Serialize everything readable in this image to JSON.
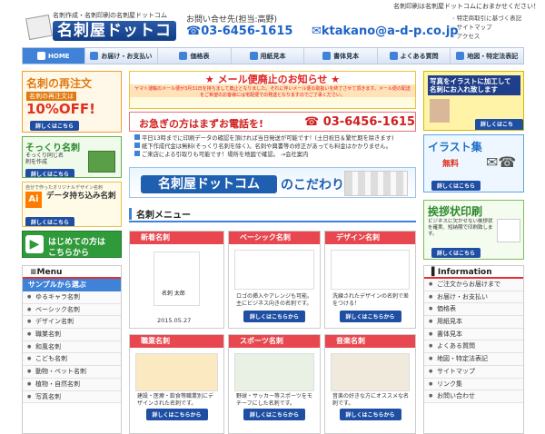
{
  "header": {
    "top_note": "名刺印刷は名刺屋ドットコムにおまかせください！",
    "logo_sub": "名刺作成・名刺印刷の名刺屋ドットコム",
    "logo_main": "名刺屋ドットコム",
    "contact_label": "お問い合せ先(担当:高野)",
    "phone": "03-6456-1615",
    "email": "ktakano@a-d-p.co.jp",
    "links": [
      "特定商取引に基づく表記",
      "サイトマップ",
      "アクセス"
    ]
  },
  "nav": [
    {
      "label": "HOME",
      "icon": "home-icon"
    },
    {
      "label": "お届け・お支払い",
      "icon": "truck-icon"
    },
    {
      "label": "価格表",
      "icon": "yen-icon"
    },
    {
      "label": "用紙見本",
      "icon": "paper-icon"
    },
    {
      "label": "書体見本",
      "icon": "font-icon"
    },
    {
      "label": "よくある質問",
      "icon": "question-icon"
    },
    {
      "label": "地図・特定法表記",
      "icon": "map-icon"
    }
  ],
  "left_banners": {
    "reorder": {
      "title": "名刺の再注文",
      "sub": "名刺の再注文は",
      "off": "10%OFF!",
      "btn": "詳しくはこちら"
    },
    "sokkuri": {
      "title": "そっくり名刺",
      "sub": "そっくり同じ名刺を作成",
      "btn": "詳しくはこちら"
    },
    "ai": {
      "top": "自分で作ったオリジナルデザイン名刺",
      "title": "データ持ち込み名刺",
      "ai_label": "Ai",
      "btn": "詳しくはこちら"
    },
    "first": {
      "line1": "はじめての方は",
      "line2": "こちらから"
    }
  },
  "left_menu": {
    "title": "Menu",
    "section": "サンプルから選ぶ",
    "items": [
      "ゆるキャラ名刺",
      "ベーシック名刺",
      "デザイン名刺",
      "職業名刺",
      "和風名刺",
      "こども名刺",
      "動物・ペット名刺",
      "植物・自然名刺",
      "写真名刺"
    ]
  },
  "notice": {
    "title": "★ メール便廃止のお知らせ ★",
    "body": "ヤマト運輸のメール便が3月31日を持ちまして廃止となりました。それに伴いメール便の取扱いを終了させて頂きます。メール便の配送をご希望のお客様には宅配便での発送となりますのでご了承ください。"
  },
  "phone_banner": {
    "text": "お急ぎの方はまずお電話を!",
    "number": "03-6456-1615"
  },
  "info_lines": [
    "平日13時までに印刷データの確認を頂ければ当日発送が可能です！(土日祝日＆繁忙期を除きます)",
    "紙下作成代金は無料(そっくり名刺を除く)。名刺や興書等の修正があっても料金はかかりません。",
    "ご来店による引取りも可能です！場所を地図で確認。 →会社案内"
  ],
  "kodawari": {
    "logo": "名刺屋ドットコム",
    "tail": "のこだわり"
  },
  "menu_title": "名刺メニュー",
  "cards": [
    {
      "title": "新着名刺",
      "color": "#e8474f",
      "desc": "",
      "date": "2015.05.27",
      "btn": ""
    },
    {
      "title": "ベーシック名刺",
      "color": "#e8474f",
      "desc": "ロゴの挿入やアレンジも可能。主にビジネス向きの名刺です。",
      "date": "",
      "btn": "詳しくはこちらから"
    },
    {
      "title": "デザイン名刺",
      "color": "#e8474f",
      "desc": "洗練されたデザインの名刺で差をつける！",
      "date": "",
      "btn": "詳しくはこちらから"
    },
    {
      "title": "職業名刺",
      "color": "#e8474f",
      "desc": "建設・医療・飲食等職業別にデザインされた名刺です。",
      "date": "",
      "btn": "詳しくはこちらから"
    },
    {
      "title": "スポーツ名刺",
      "color": "#e8474f",
      "desc": "野球・サッカー等スポーツをモチーフにした名刺です。",
      "date": "",
      "btn": "詳しくはこちらから"
    },
    {
      "title": "音楽名刺",
      "color": "#e8474f",
      "desc": "音楽の好きな方にオススメな名刺です。",
      "date": "",
      "btn": "詳しくはこちらから"
    }
  ],
  "card_texts": {
    "sample_name": "名刺 太郎"
  },
  "right_banners": {
    "photo": {
      "line1": "写真をイラストに加工して",
      "line2": "名刺にお入れ致します",
      "btn": "詳しくはこちら"
    },
    "illust": {
      "title": "イラスト集",
      "sub": "無料",
      "btn": "詳しくはこちら"
    },
    "aisatsu": {
      "title": "挨拶状印刷",
      "sub": "ビジネスに欠かせない挨拶状を確実、短納期で印刷致します。",
      "btn": "詳しくはこちら"
    }
  },
  "right_menu": {
    "title": "Information",
    "items": [
      "ご注文からお届けまで",
      "お届け・お支払い",
      "価格表",
      "用紙見本",
      "書体見本",
      "よくある質問",
      "地図・特定法表記",
      "サイトマップ",
      "リンク集",
      "お問い合わせ"
    ]
  }
}
